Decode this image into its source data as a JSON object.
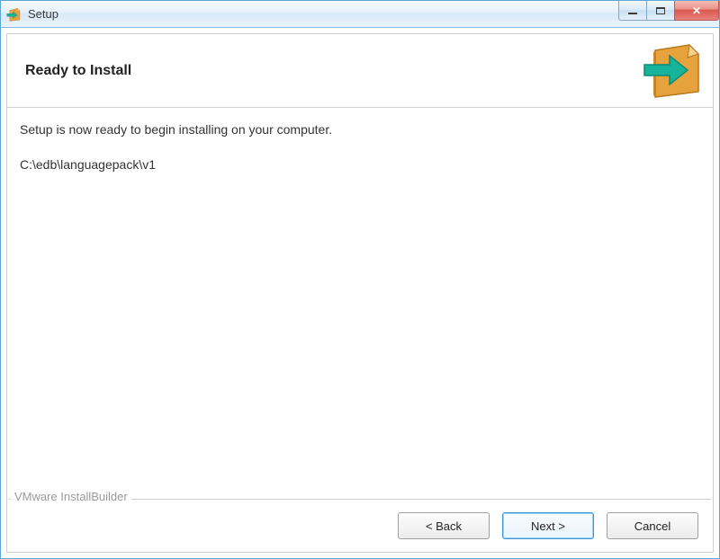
{
  "window": {
    "title": "Setup"
  },
  "header": {
    "title": "Ready to Install"
  },
  "content": {
    "message": "Setup is now ready to begin installing on your computer.",
    "path": "C:\\edb\\languagepack\\v1"
  },
  "footer": {
    "brand": "VMware InstallBuilder",
    "back": "< Back",
    "next": "Next >",
    "cancel": "Cancel"
  }
}
